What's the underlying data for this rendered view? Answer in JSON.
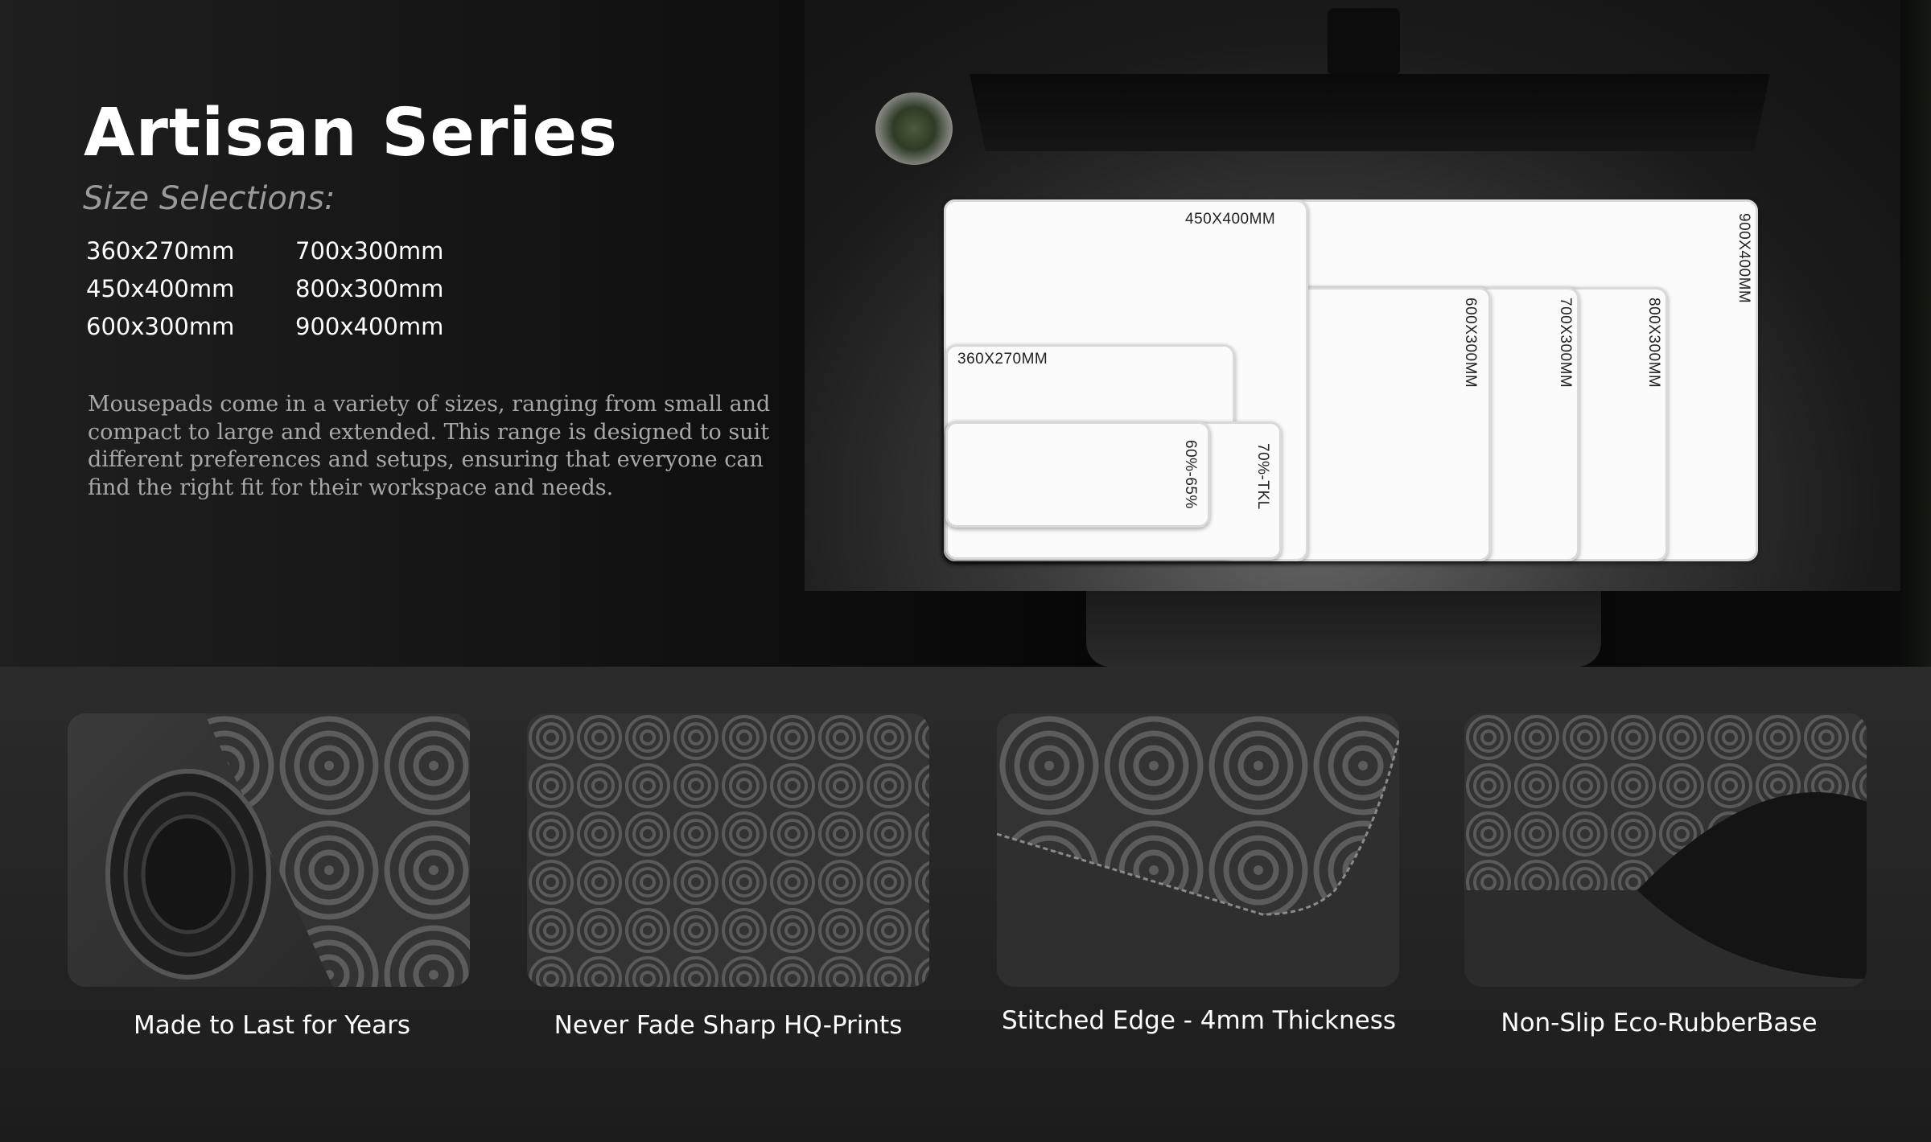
{
  "hero": {
    "title": "Artisan Series",
    "subtitle": "Size Selections:",
    "sizes": [
      "360x270mm",
      "700x300mm",
      "450x400mm",
      "800x300mm",
      "600x300mm",
      "900x400mm"
    ],
    "description": "Mousepads come in a variety of sizes, ranging from small and compact to large and extended. This range is designed to suit different preferences and setups, ensuring that everyone can find the right fit for their workspace and needs."
  },
  "diagram": {
    "pads": [
      {
        "label": "900X400MM"
      },
      {
        "label": "800X300MM"
      },
      {
        "label": "700X300MM"
      },
      {
        "label": "600X300MM"
      },
      {
        "label": "450X400MM"
      },
      {
        "label": "360X270MM"
      },
      {
        "label": "70%-TKL"
      },
      {
        "label": "60%-65%"
      }
    ]
  },
  "features": [
    {
      "caption": "Made to Last for Years",
      "icon": "rolled-mousepad-icon"
    },
    {
      "caption": "Never Fade Sharp HQ-Prints",
      "icon": "swirl-pattern-icon"
    },
    {
      "caption": "Stitched Edge - 4mm Thickness",
      "icon": "stitched-edge-icon"
    },
    {
      "caption": "Non-Slip Eco-RubberBase",
      "icon": "rubber-base-icon"
    }
  ],
  "colors": {
    "background": "#1a1a1a",
    "text": "#ffffff",
    "muted": "#9a9a9a",
    "pad": "#fbfbfb"
  }
}
